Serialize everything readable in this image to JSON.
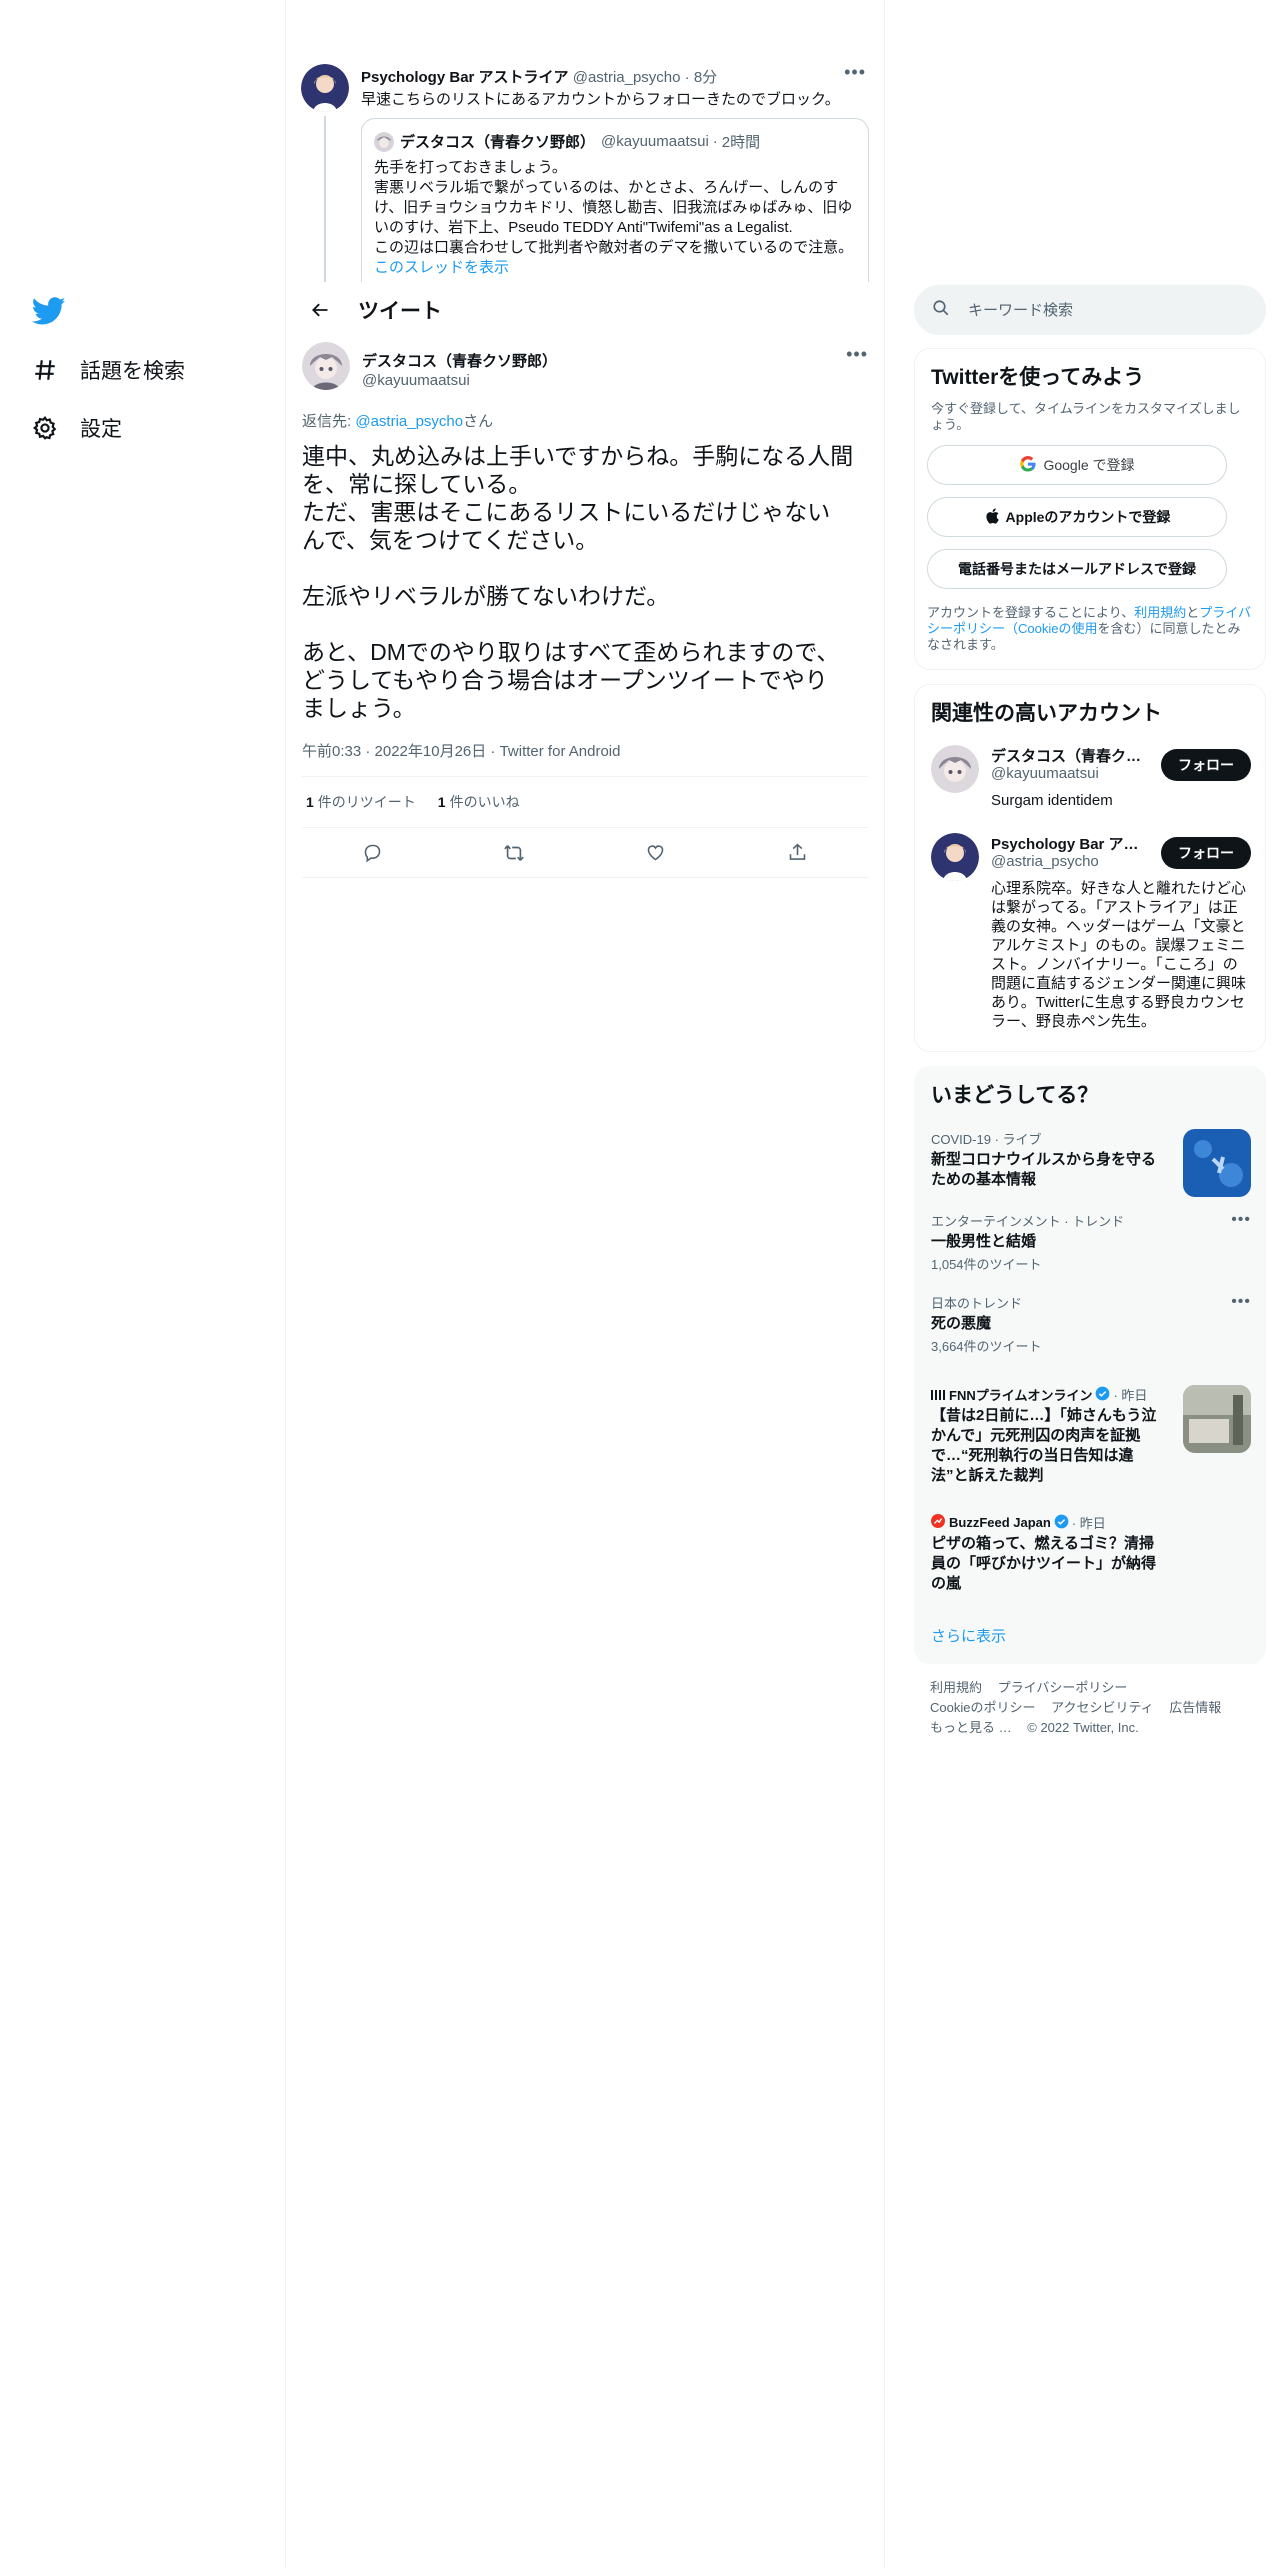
{
  "nav": {
    "items": [
      {
        "label": "話題を検索",
        "icon": "hashtag-icon"
      },
      {
        "label": "設定",
        "icon": "gear-icon"
      }
    ]
  },
  "prev_tweet": {
    "name": "Psychology Bar アストライア",
    "handle": "@astria_psycho",
    "time": "8分",
    "text": "早速こちらのリストにあるアカウントからフォローきたのでブロック。",
    "quote": {
      "name": "デスタコス（青春クソ野郎）",
      "handle": "@kayuumaatsui",
      "time": "2時間",
      "lines": [
        "先手を打っておきましょう。",
        "害悪リベラル垢で繋がっているのは、かとさよ、ろんげー、しんのす",
        "け、旧チョウショウカキドリ、憤怒し勘吉、旧我流ばみゅばみゅ、旧ゆ",
        "いのすけ、岩下上、Pseudo TEDDY Anti\"Twifemi\"as a Legalist.",
        "この辺は口裏合わせして批判者や敵対者のデマを撒いているので注意。"
      ],
      "show_thread": "このスレッドを表示"
    }
  },
  "header": {
    "title": "ツイート"
  },
  "tweet": {
    "name": "デスタコス（青春クソ野郎）",
    "handle": "@kayuumaatsui",
    "reply_prefix": "返信先: ",
    "reply_to": "@astria_psycho",
    "reply_suffix": "さん",
    "p1_l1": "連中、丸め込みは上手いですからね。手駒になる人間",
    "p1_l2": "を、常に探している。",
    "p1_l3": "ただ、害悪はそこにあるリストにいるだけじゃない",
    "p1_l4": "んで、気をつけてください。",
    "p2": "左派やリベラルが勝てないわけだ。",
    "p3_l1": "あと、DMでのやり取りはすべて歪められますので、",
    "p3_l2": "どうしてもやり合う場合はオープンツイートでやり",
    "p3_l3": "ましょう。",
    "meta": "午前0:33 · 2022年10月26日 · Twitter for Android",
    "retweets": "1",
    "retweets_label": "件のリツイート",
    "likes": "1",
    "likes_label": "件のいいね"
  },
  "search": {
    "placeholder": "キーワード検索"
  },
  "signup": {
    "title": "Twitterを使ってみよう",
    "subtitle": "今すぐ登録して、タイムラインをカスタマイズしましょう。",
    "google": "Google で登録",
    "apple": "Appleのアカウントで登録",
    "phone": "電話番号またはメールアドレスで登録",
    "legal_1": "アカウントを登録することにより、",
    "legal_terms": "利用規約",
    "legal_2": "と",
    "legal_privacy": "プライバシーポリシー（Cookieの使用",
    "legal_3": "を含む）に同意したとみなされます。"
  },
  "related": {
    "title": "関連性の高いアカウント",
    "accounts": [
      {
        "name": "デスタコス（青春クソ野郎）",
        "handle": "@kayuumaatsui",
        "bio": "Surgam identidem",
        "follow": "フォロー"
      },
      {
        "name": "Psychology Bar アストライア",
        "handle": "@astria_psycho",
        "bio": "心理系院卒。好きな人と離れたけど心は繋がってる。「アストライア」は正義の女神。ヘッダーはゲーム「文豪とアルケミスト」のもの。誤爆フェミニスト。ノンバイナリー。「こころ」の問題に直結するジェンダー関連に興味あり。Twitterに生息する野良カウンセラー、野良赤ペン先生。",
        "follow": "フォロー"
      }
    ]
  },
  "trends": {
    "title": "いまどうしてる？",
    "items": [
      {
        "context": "COVID-19 · ライブ",
        "title": "新型コロナウイルスから身を守るための基本情報"
      },
      {
        "context": "エンターテインメント · トレンド",
        "title": "一般男性と結婚",
        "count": "1,054件のツイート"
      },
      {
        "context": "日本のトレンド",
        "title": "死の悪魔",
        "count": "3,664件のツイート"
      },
      {
        "source": "FNNプライムオンライン",
        "time": "· 昨日",
        "title": "【昔は2日前に…】「姉さんもう泣かんで」元死刑囚の肉声を証拠で…“死刑執行の当日告知は違法”と訴えた裁判"
      },
      {
        "source": "BuzzFeed Japan",
        "time": "· 昨日",
        "title": "ピザの箱って、燃えるゴミ？清掃員の「呼びかけツイート」が納得の嵐"
      }
    ],
    "show_more": "さらに表示"
  },
  "footer": {
    "links": [
      "利用規約",
      "プライバシーポリシー",
      "Cookieのポリシー",
      "アクセシビリティ",
      "広告情報",
      "もっと見る …"
    ],
    "copyright": "© 2022 Twitter, Inc."
  },
  "colors": {
    "accent": "#1d9bf0",
    "text": "#0f1419",
    "secondary": "#536471",
    "border": "#eff3f4"
  }
}
